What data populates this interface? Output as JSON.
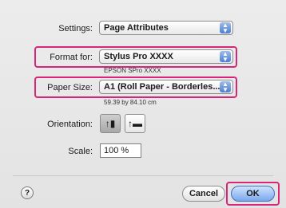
{
  "settings": {
    "label": "Settings:",
    "value": "Page Attributes"
  },
  "format_for": {
    "label": "Format for:",
    "value": "Stylus Pro XXXX",
    "subtitle": "EPSON SPro XXXX"
  },
  "paper_size": {
    "label": "Paper Size:",
    "value": "A1 (Roll Paper - Borderles...",
    "subtitle": "59.39 by 84.10 cm"
  },
  "orientation": {
    "label": "Orientation:",
    "selected": "portrait"
  },
  "scale": {
    "label": "Scale:",
    "value": "100 %"
  },
  "footer": {
    "help": "?",
    "cancel_label": "Cancel",
    "ok_label": "OK"
  },
  "colors": {
    "highlight": "#d6267a",
    "popup_arrow": "#4c7fd3"
  }
}
